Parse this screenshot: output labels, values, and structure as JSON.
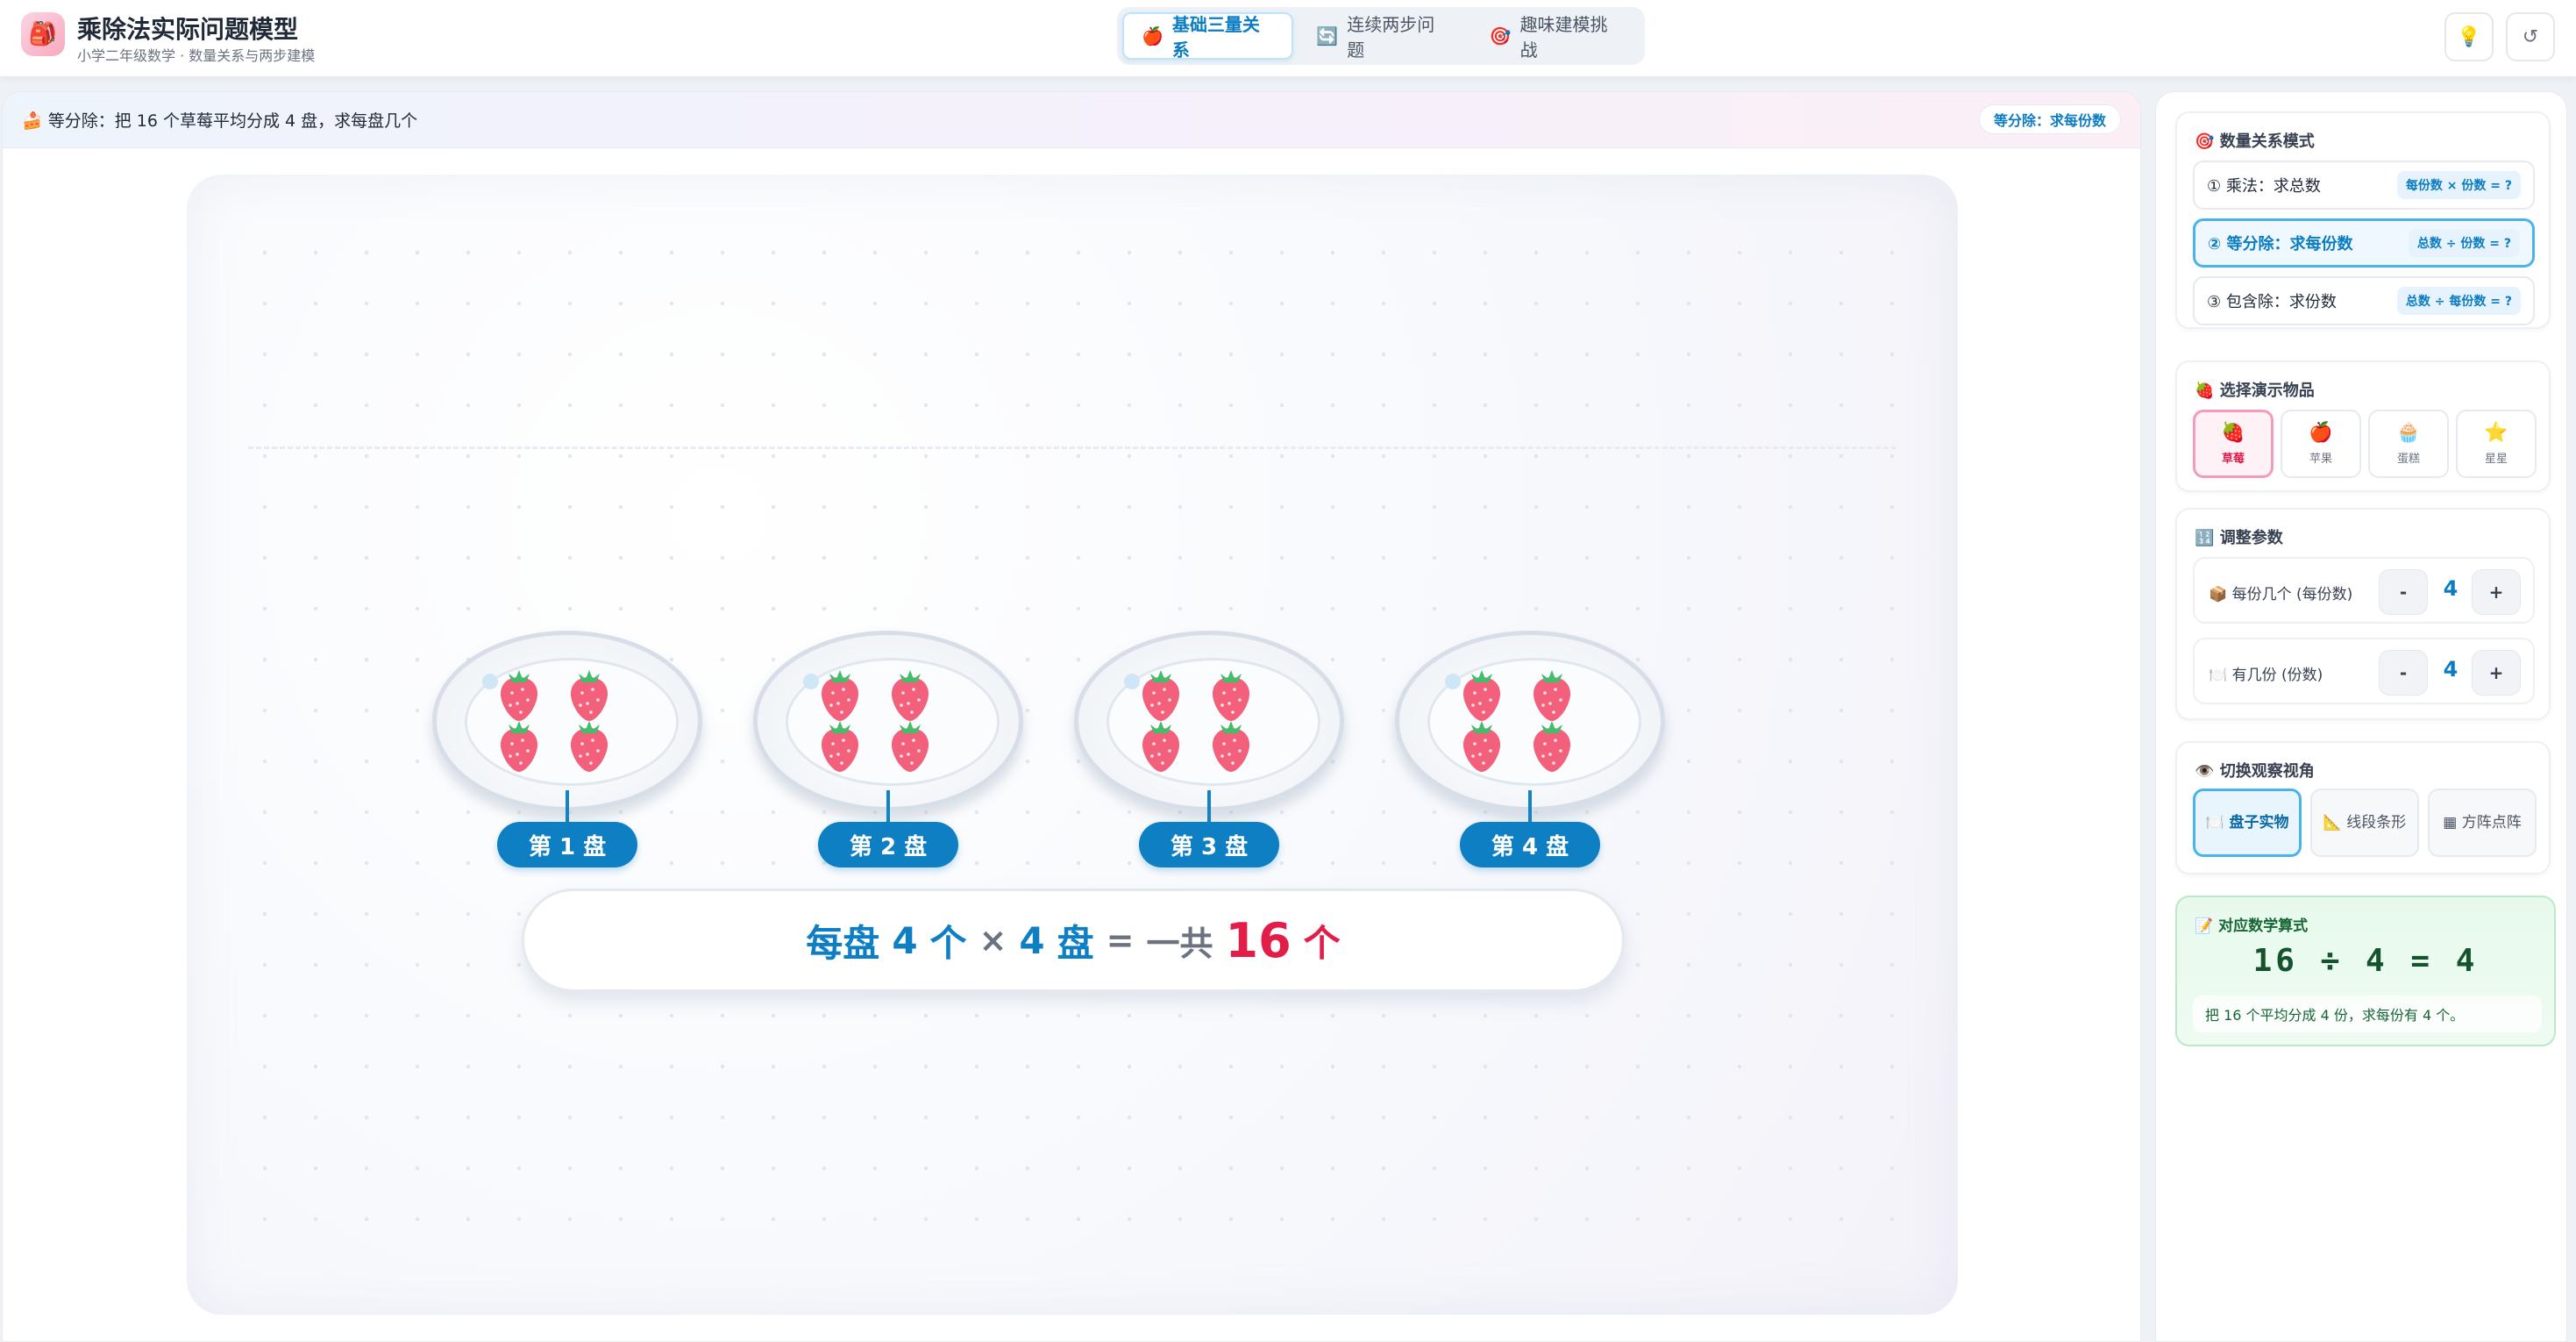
{
  "header": {
    "logo_icon": "🎒",
    "title": "乘除法实际问题模型",
    "subtitle": "小学二年级数学 · 数量关系与两步建模",
    "tabs": [
      {
        "icon": "🍎",
        "label": "基础三量关系",
        "active": true
      },
      {
        "icon": "🔄",
        "label": "连续两步问题",
        "active": false
      },
      {
        "icon": "🎯",
        "label": "趣味建模挑战",
        "active": false
      }
    ],
    "hint_icon": "💡",
    "reset_icon": "↺"
  },
  "stage": {
    "problem_icon": "🍰",
    "problem_text": "等分除：把 16 个草莓平均分成 4 盘，求每盘几个",
    "mode_badge": "等分除：求每份数",
    "plates": [
      {
        "label": "第 1 盘",
        "items": 4
      },
      {
        "label": "第 2 盘",
        "items": 4
      },
      {
        "label": "第 3 盘",
        "items": 4
      },
      {
        "label": "第 4 盘",
        "items": 4
      }
    ],
    "equation": {
      "part1": "每盘",
      "per": "4",
      "unit1": "个",
      "times": "×",
      "count": "4",
      "unit2": "盘",
      "eq": "=",
      "total_prefix": "一共",
      "total": "16",
      "unit3": "个"
    }
  },
  "sidebar": {
    "modes_title": "数量关系模式",
    "modes_icon": "🎯",
    "modes": [
      {
        "label": "① 乘法：求总数",
        "formula": "每份数 × 份数 = ?",
        "active": false
      },
      {
        "label": "② 等分除：求每份数",
        "formula": "总数 ÷ 份数 = ?",
        "active": true
      },
      {
        "label": "③ 包含除：求份数",
        "formula": "总数 ÷ 每份数 = ?",
        "active": false
      }
    ],
    "objects_title": "选择演示物品",
    "objects_icon": "🍓",
    "objects": [
      {
        "icon": "🍓",
        "label": "草莓",
        "active": true
      },
      {
        "icon": "🍎",
        "label": "苹果",
        "active": false
      },
      {
        "icon": "🧁",
        "label": "蛋糕",
        "active": false
      },
      {
        "icon": "⭐",
        "label": "星星",
        "active": false
      }
    ],
    "params_title": "调整参数",
    "params_icon": "🔢",
    "params": [
      {
        "icon": "📦",
        "label": "每份几个 (每份数)",
        "value": "4",
        "minus": "-",
        "plus": "+"
      },
      {
        "icon": "🍽️",
        "label": "有几份 (份数)",
        "value": "4",
        "minus": "-",
        "plus": "+"
      }
    ],
    "views_title": "切换观察视角",
    "views_icon": "👁️",
    "views": [
      {
        "label": "🍽️ 盘子实物",
        "active": true
      },
      {
        "label": "📐 线段条形",
        "active": false
      },
      {
        "label": "▦ 方阵点阵",
        "active": false
      }
    ],
    "formula_title": "📝 对应数学算式",
    "formula": "16 ÷ 4 = 4",
    "formula_note": "把 16 个平均分成 4 份，求每份有 4 个。"
  }
}
